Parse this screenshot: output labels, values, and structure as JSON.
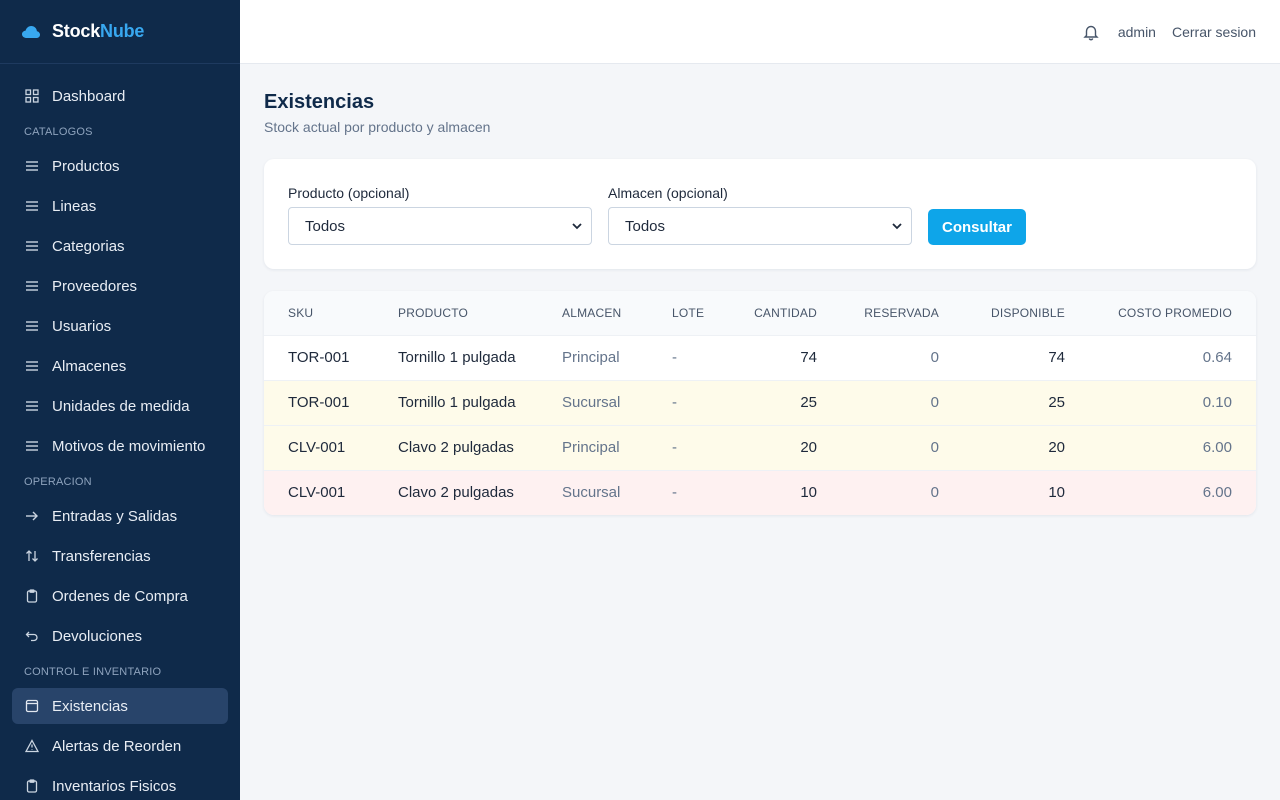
{
  "brand": {
    "part1": "Stock",
    "part2": "Nube"
  },
  "sidebar": {
    "dashboard": "Dashboard",
    "sections": {
      "catalogos": "CATALOGOS",
      "operacion": "OPERACION",
      "control": "CONTROL E INVENTARIO"
    },
    "catalogos": [
      "Productos",
      "Lineas",
      "Categorias",
      "Proveedores",
      "Usuarios",
      "Almacenes",
      "Unidades de medida",
      "Motivos de movimiento"
    ],
    "operacion": [
      "Entradas y Salidas",
      "Transferencias",
      "Ordenes de Compra",
      "Devoluciones"
    ],
    "control": [
      "Existencias",
      "Alertas de Reorden",
      "Inventarios Fisicos"
    ]
  },
  "topbar": {
    "user": "admin",
    "logout": "Cerrar sesion"
  },
  "page": {
    "title": "Existencias",
    "subtitle": "Stock actual por producto y almacen"
  },
  "filters": {
    "producto_label": "Producto (opcional)",
    "producto_value": "Todos",
    "almacen_label": "Almacen (opcional)",
    "almacen_value": "Todos",
    "submit": "Consultar"
  },
  "table": {
    "headers": [
      "SKU",
      "PRODUCTO",
      "ALMACEN",
      "LOTE",
      "CANTIDAD",
      "RESERVADA",
      "DISPONIBLE",
      "COSTO PROMEDIO"
    ],
    "rows": [
      {
        "sku": "TOR-001",
        "producto": "Tornillo 1 pulgada",
        "almacen": "Principal",
        "lote": "-",
        "cantidad": "74",
        "reservada": "0",
        "disponible": "74",
        "costo": "0.64",
        "status": "normal"
      },
      {
        "sku": "TOR-001",
        "producto": "Tornillo 1 pulgada",
        "almacen": "Sucursal",
        "lote": "-",
        "cantidad": "25",
        "reservada": "0",
        "disponible": "25",
        "costo": "0.10",
        "status": "warn"
      },
      {
        "sku": "CLV-001",
        "producto": "Clavo 2 pulgadas",
        "almacen": "Principal",
        "lote": "-",
        "cantidad": "20",
        "reservada": "0",
        "disponible": "20",
        "costo": "6.00",
        "status": "warn"
      },
      {
        "sku": "CLV-001",
        "producto": "Clavo 2 pulgadas",
        "almacen": "Sucursal",
        "lote": "-",
        "cantidad": "10",
        "reservada": "0",
        "disponible": "10",
        "costo": "6.00",
        "status": "low"
      }
    ]
  },
  "colors": {
    "sidebar_bg": "#0f2a4a",
    "accent": "#0ea5e9",
    "row_warn": "#fefbea",
    "row_low": "#fef1f1"
  }
}
